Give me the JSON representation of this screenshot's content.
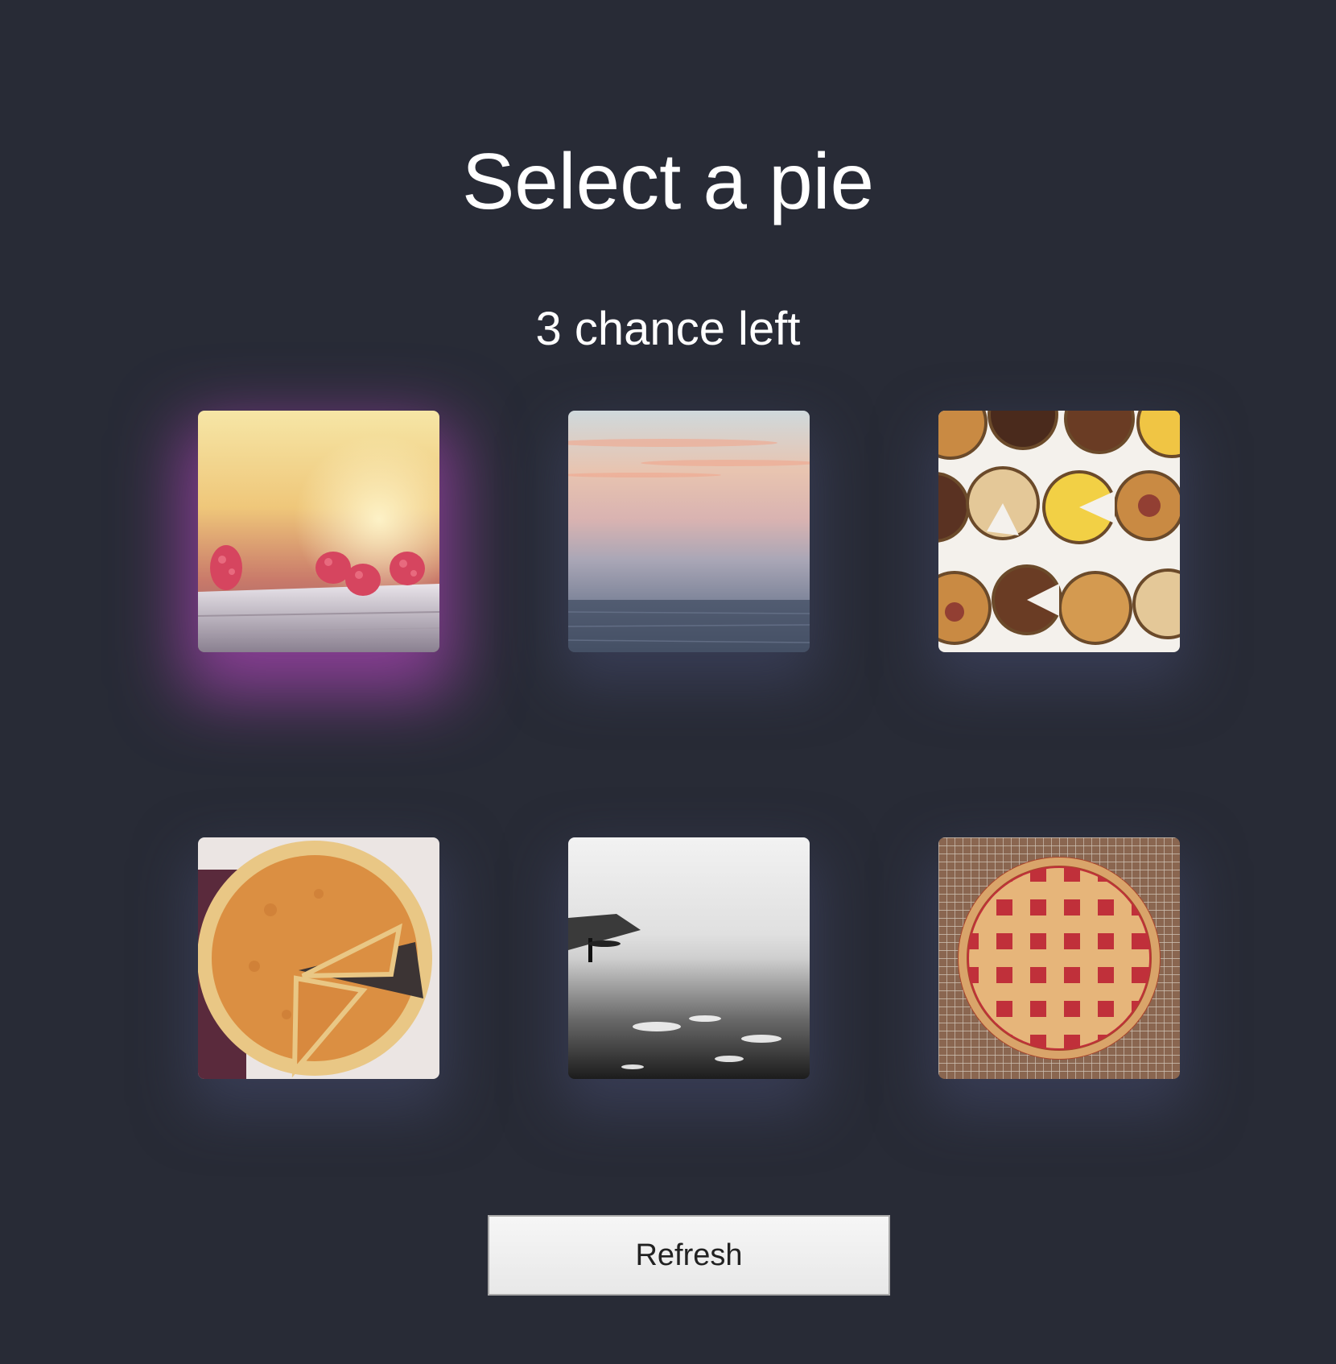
{
  "title": "Select a pie",
  "subtitle": "3 chance left",
  "tiles": [
    {
      "subject": "raspberries on a ledge in golden light",
      "selected": true
    },
    {
      "subject": "misty sea at dawn",
      "selected": false
    },
    {
      "subject": "assorted pies viewed from above",
      "selected": false
    },
    {
      "subject": "pumpkin pie with a slice cut",
      "selected": false
    },
    {
      "subject": "black and white beach with surfer",
      "selected": false
    },
    {
      "subject": "lattice cherry pie on cooling rack",
      "selected": false
    }
  ],
  "refresh_label": "Refresh",
  "colors": {
    "background": "#282b36",
    "selected_glow": "#aa46b4",
    "tile_glow": "#464a6e"
  }
}
